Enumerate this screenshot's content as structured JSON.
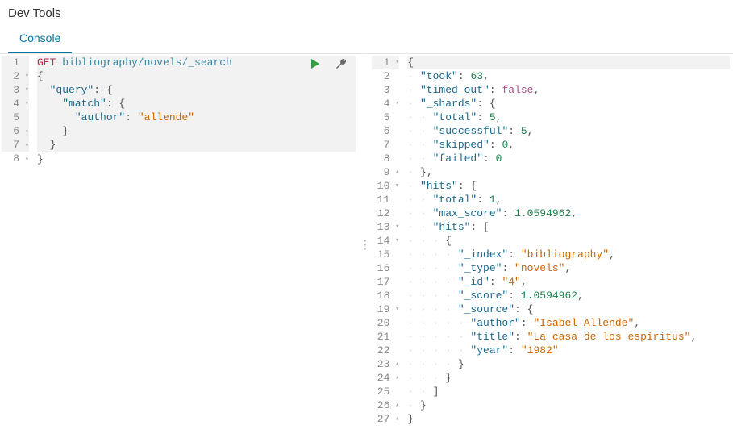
{
  "header": {
    "title": "Dev Tools"
  },
  "tabs": [
    {
      "label": "Console",
      "active": true
    }
  ],
  "actions": {
    "run": "run-request",
    "wrench": "settings"
  },
  "request": {
    "method": "GET",
    "path": "bibliography/novels/_search",
    "lines": [
      {
        "n": 1,
        "fold": "",
        "hl": true,
        "tokens": [
          [
            "method",
            "GET"
          ],
          [
            "text",
            " "
          ],
          [
            "path",
            "bibliography/novels/_search"
          ]
        ]
      },
      {
        "n": 2,
        "fold": "▾",
        "hl": true,
        "tokens": [
          [
            "punc",
            "{"
          ]
        ]
      },
      {
        "n": 3,
        "fold": "▾",
        "hl": true,
        "tokens": [
          [
            "text",
            "  "
          ],
          [
            "k-key",
            "\"query\""
          ],
          [
            "punc",
            ": {"
          ]
        ]
      },
      {
        "n": 4,
        "fold": "▾",
        "hl": true,
        "tokens": [
          [
            "text",
            "    "
          ],
          [
            "k-key",
            "\"match\""
          ],
          [
            "punc",
            ": {"
          ]
        ]
      },
      {
        "n": 5,
        "fold": "",
        "hl": true,
        "tokens": [
          [
            "text",
            "      "
          ],
          [
            "k-key",
            "\"author\""
          ],
          [
            "punc",
            ": "
          ],
          [
            "k-str",
            "\"allende\""
          ]
        ]
      },
      {
        "n": 6,
        "fold": "▴",
        "hl": true,
        "tokens": [
          [
            "text",
            "    "
          ],
          [
            "punc",
            "}"
          ]
        ]
      },
      {
        "n": 7,
        "fold": "▴",
        "hl": true,
        "tokens": [
          [
            "text",
            "  "
          ],
          [
            "punc",
            "}"
          ]
        ]
      },
      {
        "n": 8,
        "fold": "▴",
        "hl": false,
        "tokens": [
          [
            "punc",
            "}"
          ],
          [
            "cursor",
            "|"
          ]
        ]
      }
    ]
  },
  "response": {
    "lines": [
      {
        "n": 1,
        "fold": "▾",
        "tokens": [
          [
            "punc",
            "{"
          ]
        ]
      },
      {
        "n": 2,
        "fold": "",
        "tokens": [
          [
            "text",
            "  "
          ],
          [
            "k-key",
            "\"took\""
          ],
          [
            "punc",
            ": "
          ],
          [
            "k-num",
            "63"
          ],
          [
            "punc",
            ","
          ]
        ]
      },
      {
        "n": 3,
        "fold": "",
        "tokens": [
          [
            "text",
            "  "
          ],
          [
            "k-key",
            "\"timed_out\""
          ],
          [
            "punc",
            ": "
          ],
          [
            "k-bool",
            "false"
          ],
          [
            "punc",
            ","
          ]
        ]
      },
      {
        "n": 4,
        "fold": "▾",
        "tokens": [
          [
            "text",
            "  "
          ],
          [
            "k-key",
            "\"_shards\""
          ],
          [
            "punc",
            ": {"
          ]
        ]
      },
      {
        "n": 5,
        "fold": "",
        "tokens": [
          [
            "text",
            "    "
          ],
          [
            "k-key",
            "\"total\""
          ],
          [
            "punc",
            ": "
          ],
          [
            "k-num",
            "5"
          ],
          [
            "punc",
            ","
          ]
        ]
      },
      {
        "n": 6,
        "fold": "",
        "tokens": [
          [
            "text",
            "    "
          ],
          [
            "k-key",
            "\"successful\""
          ],
          [
            "punc",
            ": "
          ],
          [
            "k-num",
            "5"
          ],
          [
            "punc",
            ","
          ]
        ]
      },
      {
        "n": 7,
        "fold": "",
        "tokens": [
          [
            "text",
            "    "
          ],
          [
            "k-key",
            "\"skipped\""
          ],
          [
            "punc",
            ": "
          ],
          [
            "k-num",
            "0"
          ],
          [
            "punc",
            ","
          ]
        ]
      },
      {
        "n": 8,
        "fold": "",
        "tokens": [
          [
            "text",
            "    "
          ],
          [
            "k-key",
            "\"failed\""
          ],
          [
            "punc",
            ": "
          ],
          [
            "k-num",
            "0"
          ]
        ]
      },
      {
        "n": 9,
        "fold": "▴",
        "tokens": [
          [
            "text",
            "  "
          ],
          [
            "punc",
            "},"
          ]
        ]
      },
      {
        "n": 10,
        "fold": "▾",
        "tokens": [
          [
            "text",
            "  "
          ],
          [
            "k-key",
            "\"hits\""
          ],
          [
            "punc",
            ": {"
          ]
        ]
      },
      {
        "n": 11,
        "fold": "",
        "tokens": [
          [
            "text",
            "    "
          ],
          [
            "k-key",
            "\"total\""
          ],
          [
            "punc",
            ": "
          ],
          [
            "k-num",
            "1"
          ],
          [
            "punc",
            ","
          ]
        ]
      },
      {
        "n": 12,
        "fold": "",
        "tokens": [
          [
            "text",
            "    "
          ],
          [
            "k-key",
            "\"max_score\""
          ],
          [
            "punc",
            ": "
          ],
          [
            "k-num",
            "1.0594962"
          ],
          [
            "punc",
            ","
          ]
        ]
      },
      {
        "n": 13,
        "fold": "▾",
        "tokens": [
          [
            "text",
            "    "
          ],
          [
            "k-key",
            "\"hits\""
          ],
          [
            "punc",
            ": ["
          ]
        ]
      },
      {
        "n": 14,
        "fold": "▾",
        "tokens": [
          [
            "text",
            "      "
          ],
          [
            "punc",
            "{"
          ]
        ]
      },
      {
        "n": 15,
        "fold": "",
        "tokens": [
          [
            "text",
            "        "
          ],
          [
            "k-key",
            "\"_index\""
          ],
          [
            "punc",
            ": "
          ],
          [
            "k-str",
            "\"bibliography\""
          ],
          [
            "punc",
            ","
          ]
        ]
      },
      {
        "n": 16,
        "fold": "",
        "tokens": [
          [
            "text",
            "        "
          ],
          [
            "k-key",
            "\"_type\""
          ],
          [
            "punc",
            ": "
          ],
          [
            "k-str",
            "\"novels\""
          ],
          [
            "punc",
            ","
          ]
        ]
      },
      {
        "n": 17,
        "fold": "",
        "tokens": [
          [
            "text",
            "        "
          ],
          [
            "k-key",
            "\"_id\""
          ],
          [
            "punc",
            ": "
          ],
          [
            "k-str",
            "\"4\""
          ],
          [
            "punc",
            ","
          ]
        ]
      },
      {
        "n": 18,
        "fold": "",
        "tokens": [
          [
            "text",
            "        "
          ],
          [
            "k-key",
            "\"_score\""
          ],
          [
            "punc",
            ": "
          ],
          [
            "k-num",
            "1.0594962"
          ],
          [
            "punc",
            ","
          ]
        ]
      },
      {
        "n": 19,
        "fold": "▾",
        "tokens": [
          [
            "text",
            "        "
          ],
          [
            "k-key",
            "\"_source\""
          ],
          [
            "punc",
            ": {"
          ]
        ]
      },
      {
        "n": 20,
        "fold": "",
        "tokens": [
          [
            "text",
            "          "
          ],
          [
            "k-key",
            "\"author\""
          ],
          [
            "punc",
            ": "
          ],
          [
            "k-str",
            "\"Isabel Allende\""
          ],
          [
            "punc",
            ","
          ]
        ]
      },
      {
        "n": 21,
        "fold": "",
        "tokens": [
          [
            "text",
            "          "
          ],
          [
            "k-key",
            "\"title\""
          ],
          [
            "punc",
            ": "
          ],
          [
            "k-str",
            "\"La casa de los espíritus\""
          ],
          [
            "punc",
            ","
          ]
        ]
      },
      {
        "n": 22,
        "fold": "",
        "tokens": [
          [
            "text",
            "          "
          ],
          [
            "k-key",
            "\"year\""
          ],
          [
            "punc",
            ": "
          ],
          [
            "k-str",
            "\"1982\""
          ]
        ]
      },
      {
        "n": 23,
        "fold": "▴",
        "tokens": [
          [
            "text",
            "        "
          ],
          [
            "punc",
            "}"
          ]
        ]
      },
      {
        "n": 24,
        "fold": "▴",
        "tokens": [
          [
            "text",
            "      "
          ],
          [
            "punc",
            "}"
          ]
        ]
      },
      {
        "n": 25,
        "fold": "",
        "tokens": [
          [
            "text",
            "    "
          ],
          [
            "punc",
            "]"
          ]
        ]
      },
      {
        "n": 26,
        "fold": "▴",
        "tokens": [
          [
            "text",
            "  "
          ],
          [
            "punc",
            "}"
          ]
        ]
      },
      {
        "n": 27,
        "fold": "▴",
        "tokens": [
          [
            "punc",
            "}"
          ]
        ]
      }
    ]
  },
  "splitter_glyph": "⋮"
}
